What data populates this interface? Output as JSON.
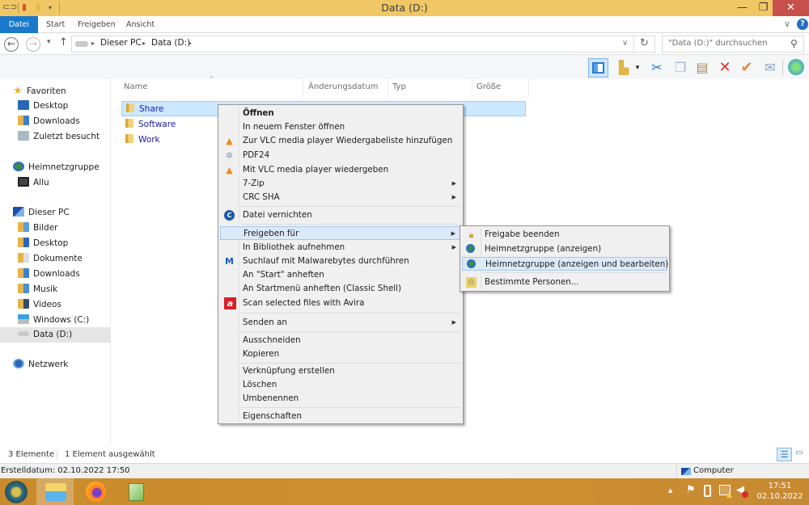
{
  "window": {
    "title": "Data (D:)",
    "minimize_symbol": "—",
    "maximize_symbol": "❐",
    "close_symbol": "✕"
  },
  "ribbon": {
    "tabs": [
      {
        "label": "Datei",
        "active": true
      },
      {
        "label": "Start"
      },
      {
        "label": "Freigeben"
      },
      {
        "label": "Ansicht"
      }
    ],
    "expand_symbol": "∨",
    "help_symbol": "?"
  },
  "address": {
    "back_symbol": "←",
    "forward_symbol": "→",
    "recent_symbol": "▾",
    "up_symbol": "↑",
    "breadcrumb": [
      "Dieser PC",
      "Data (D:)"
    ],
    "separator": "▸",
    "dropdown_symbol": "∨",
    "refresh_symbol": "↻",
    "search_placeholder": "\"Data (D:)\" durchsuchen",
    "search_icon": "⚲"
  },
  "toolbar": {
    "icons": [
      "preview-pane-icon",
      "folder-options-icon",
      "cut-icon",
      "copy-icon",
      "paste-icon",
      "delete-icon",
      "properties-check-icon",
      "email-icon",
      "classic-shell-icon"
    ]
  },
  "nav": {
    "groups": [
      {
        "label": "Favoriten",
        "items": [
          "Desktop",
          "Downloads",
          "Zuletzt besucht"
        ]
      },
      {
        "label": "Heimnetzgruppe",
        "items": [
          "Allu"
        ]
      },
      {
        "label": "Dieser PC",
        "items": [
          "Bilder",
          "Desktop",
          "Dokumente",
          "Downloads",
          "Musik",
          "Videos",
          "Windows (C:)",
          "Data (D:)"
        ],
        "selected": "Data (D:)"
      },
      {
        "label": "Netzwerk",
        "items": []
      }
    ]
  },
  "filelist": {
    "columns": [
      "Name",
      "Änderungsdatum",
      "Typ",
      "Größe"
    ],
    "sort_indicator": "^",
    "files": [
      {
        "name": "Share",
        "selected": true
      },
      {
        "name": "Software"
      },
      {
        "name": "Work"
      }
    ]
  },
  "context_menu": {
    "items": [
      {
        "label": "Öffnen",
        "bold": true
      },
      {
        "label": "In neuem Fenster öffnen"
      },
      {
        "label": "Zur VLC media player Wiedergabeliste hinzufügen",
        "icon": "vlc-icon"
      },
      {
        "label": "PDF24",
        "icon": "pdf24-icon"
      },
      {
        "label": "Mit VLC media player wiedergeben",
        "icon": "vlc-icon"
      },
      {
        "label": "7-Zip",
        "submenu": true
      },
      {
        "label": "CRC SHA",
        "submenu": true
      },
      {
        "label": "Datei vernichten",
        "icon": "shredder-icon"
      },
      {
        "label": "Freigeben für",
        "submenu": true,
        "highlighted": true
      },
      {
        "label": "In Bibliothek aufnehmen",
        "submenu": true
      },
      {
        "label": "Suchlauf mit Malwarebytes durchführen",
        "icon": "malwarebytes-icon"
      },
      {
        "label": "An \"Start\" anheften"
      },
      {
        "label": "An Startmenü anheften (Classic Shell)"
      },
      {
        "label": "Scan selected files with Avira",
        "icon": "avira-icon"
      },
      {
        "label": "Senden an",
        "submenu": true
      },
      {
        "label": "Ausschneiden"
      },
      {
        "label": "Kopieren"
      },
      {
        "label": "Verknüpfung erstellen"
      },
      {
        "label": "Löschen"
      },
      {
        "label": "Umbenennen"
      },
      {
        "label": "Eigenschaften"
      }
    ],
    "arrow_symbol": "▶"
  },
  "submenu": {
    "items": [
      {
        "label": "Freigabe beenden",
        "icon": "lock-icon"
      },
      {
        "label": "Heimnetzgruppe (anzeigen)",
        "icon": "homegroup-icon"
      },
      {
        "label": "Heimnetzgruppe (anzeigen und bearbeiten)",
        "icon": "homegroup-icon",
        "highlighted": true
      },
      {
        "label": "Bestimmte Personen...",
        "icon": "people-icon"
      }
    ]
  },
  "status": {
    "count": "3 Elemente",
    "selected": "1 Element ausgewählt",
    "details": "Erstelldatum: 02.10.2022 17:50",
    "location": "Computer"
  },
  "taskbar": {
    "apps": [
      "classic-shell-start",
      "file-explorer",
      "firefox",
      "notepad-plus-plus"
    ],
    "tray_up_symbol": "▲",
    "time": "17:51",
    "date": "02.10.2022"
  },
  "colors": {
    "title_bar": "#f0c764",
    "datei_tab": "#1979ca",
    "close_button": "#c7504c",
    "selection": "#cce8ff",
    "taskbar": "#c98b2c"
  }
}
